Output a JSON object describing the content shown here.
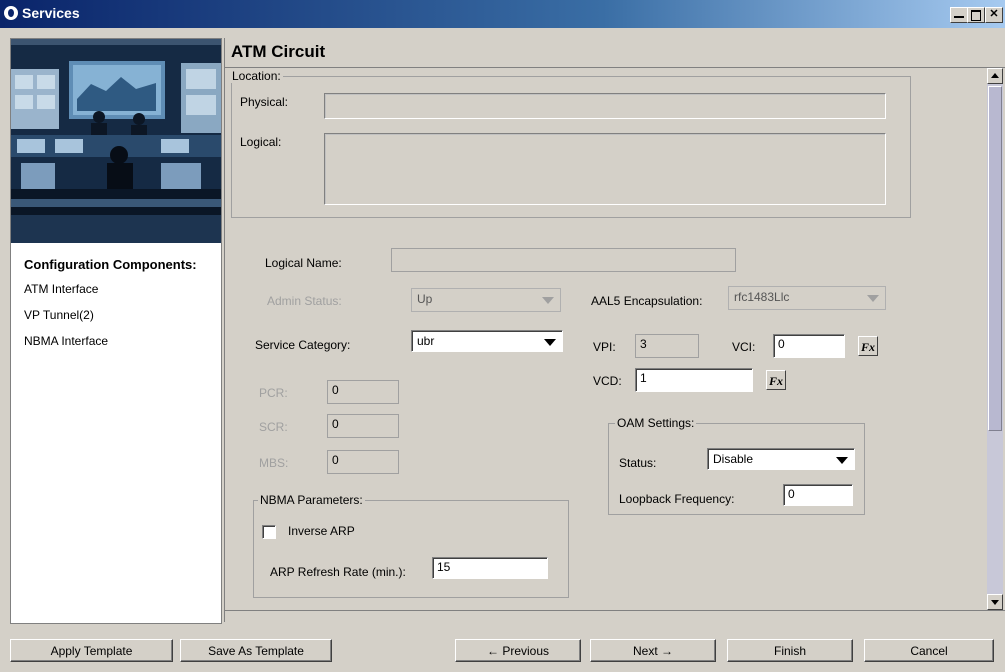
{
  "window": {
    "title": "Services"
  },
  "left": {
    "heading": "Configuration Components:",
    "items": [
      {
        "label": "ATM Interface"
      },
      {
        "label": "VP Tunnel(2)"
      },
      {
        "label": "NBMA Interface"
      }
    ]
  },
  "main": {
    "title": "ATM Circuit",
    "location": {
      "legend": "Location:",
      "physical_label": "Physical:",
      "physical_value": "",
      "logical_label": "Logical:",
      "logical_value": ""
    },
    "logical_name": {
      "label": "Logical Name:",
      "value": ""
    },
    "admin_status": {
      "label": "Admin Status:",
      "value": "Up"
    },
    "aal5": {
      "label": "AAL5 Encapsulation:",
      "value": "rfc1483Llc"
    },
    "service_category": {
      "label": "Service Category:",
      "value": "ubr"
    },
    "vpi": {
      "label": "VPI:",
      "value": "3"
    },
    "vci": {
      "label": "VCI:",
      "value": "0"
    },
    "vcd": {
      "label": "VCD:",
      "value": "1"
    },
    "fx_label": "Fx",
    "pcr": {
      "label": "PCR:",
      "value": "0"
    },
    "scr": {
      "label": "SCR:",
      "value": "0"
    },
    "mbs": {
      "label": "MBS:",
      "value": "0"
    },
    "oam": {
      "legend": "OAM Settings:",
      "status_label": "Status:",
      "status_value": "Disable",
      "loopback_label": "Loopback Frequency:",
      "loopback_value": "0"
    },
    "nbma": {
      "legend": "NBMA Parameters:",
      "inverse_arp_label": "Inverse ARP",
      "inverse_arp_checked": false,
      "arp_refresh_label": "ARP Refresh Rate (min.):",
      "arp_refresh_value": "15"
    }
  },
  "footer": {
    "apply_template": "Apply Template",
    "save_as_template": "Save As Template",
    "previous": "← Previous",
    "next": "Next →",
    "finish": "Finish",
    "cancel": "Cancel"
  },
  "icons": {
    "app": "services-app-icon",
    "minimize": "minimize-icon",
    "maximize": "maximize-icon",
    "close": "close-icon",
    "dropdown": "chevron-down-icon",
    "scroll_up": "arrow-up-icon",
    "scroll_down": "arrow-down-icon"
  }
}
